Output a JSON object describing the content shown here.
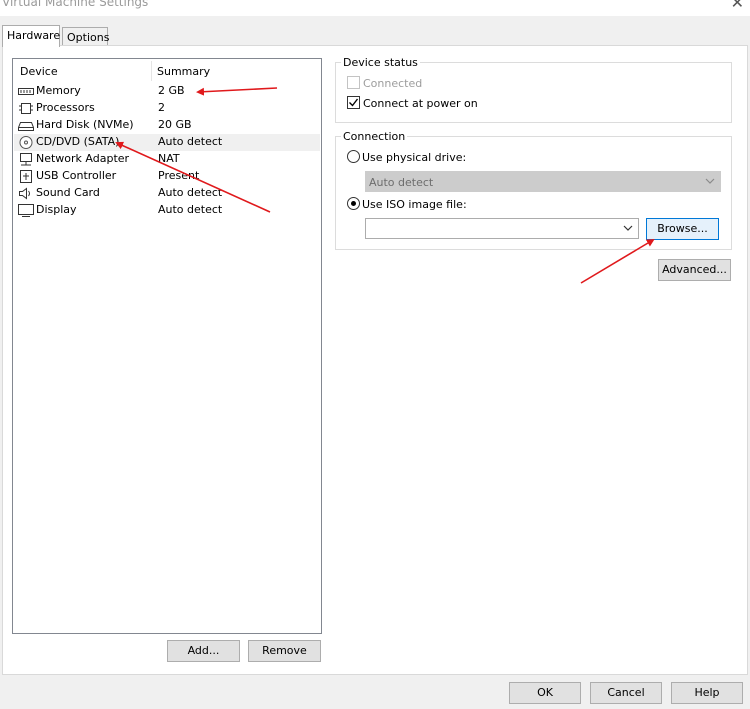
{
  "window": {
    "title": "Virtual Machine Settings",
    "close_glyph": "✕"
  },
  "tabs": [
    {
      "label": "Hardware",
      "active": true
    },
    {
      "label": "Options",
      "active": false
    }
  ],
  "device_list": {
    "col_device": "Device",
    "col_summary": "Summary",
    "items": [
      {
        "name": "Memory",
        "summary": "2 GB",
        "icon": "memory-icon"
      },
      {
        "name": "Processors",
        "summary": "2",
        "icon": "processor-icon"
      },
      {
        "name": "Hard Disk (NVMe)",
        "summary": "20 GB",
        "icon": "hard-disk-icon"
      },
      {
        "name": "CD/DVD (SATA)",
        "summary": "Auto detect",
        "icon": "cd-dvd-icon",
        "selected": true
      },
      {
        "name": "Network Adapter",
        "summary": "NAT",
        "icon": "network-adapter-icon"
      },
      {
        "name": "USB Controller",
        "summary": "Present",
        "icon": "usb-icon"
      },
      {
        "name": "Sound Card",
        "summary": "Auto detect",
        "icon": "sound-icon"
      },
      {
        "name": "Display",
        "summary": "Auto detect",
        "icon": "display-icon"
      }
    ],
    "add_label": "Add...",
    "remove_label": "Remove"
  },
  "device_status": {
    "title": "Device status",
    "connected_label": "Connected",
    "connected_checked": false,
    "connect_power_label": "Connect at power on",
    "connect_power_checked": true
  },
  "connection": {
    "title": "Connection",
    "physical_label": "Use physical drive:",
    "physical_value": "Auto detect",
    "iso_label": "Use ISO image file:",
    "iso_value": "",
    "browse_label": "Browse...",
    "advanced_label": "Advanced..."
  },
  "footer": {
    "ok_label": "OK",
    "cancel_label": "Cancel",
    "help_label": "Help"
  },
  "colors": {
    "annotation_arrow": "#e0191c"
  }
}
